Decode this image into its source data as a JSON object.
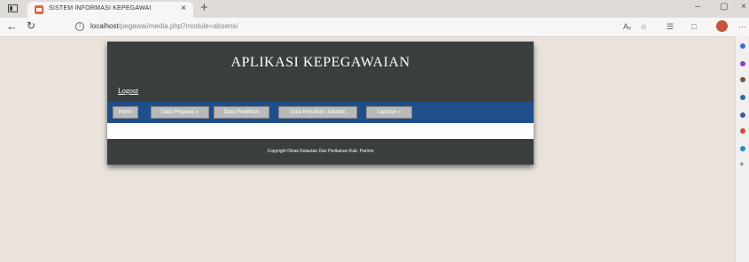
{
  "browser": {
    "tab_title": "SISTEM INFORMASI KEPEGAWAI",
    "tab_close": "×",
    "new_tab": "+",
    "url_host": "localhost",
    "url_path": "/pegawai/media.php?module=absensi",
    "window_controls": [
      "–",
      "▢",
      "×"
    ],
    "toolbar_icons": [
      "read-aloud-icon",
      "favorite-add-icon",
      "favorites-icon",
      "collections-icon",
      "profile-icon",
      "more-icon"
    ],
    "more": "···"
  },
  "page": {
    "title": "APLIKASI KEPEGAWAIAN",
    "logout": "Logout",
    "nav": [
      "Home",
      "Data Pegawai »",
      "Data Pelatihan",
      "Data Kenaikan Jabatan",
      "Laporan »"
    ],
    "footer": "Copyright Dinas Kelautan Dan Perikanan Kab. Parimo"
  },
  "sidebar": {
    "add": "+"
  },
  "colors": {
    "page_bg": "#eae3dc",
    "header_bg": "#3a3f3e",
    "navbar_bg": "#1f4e8b",
    "nav_button_bg": "#b9b9b9"
  }
}
